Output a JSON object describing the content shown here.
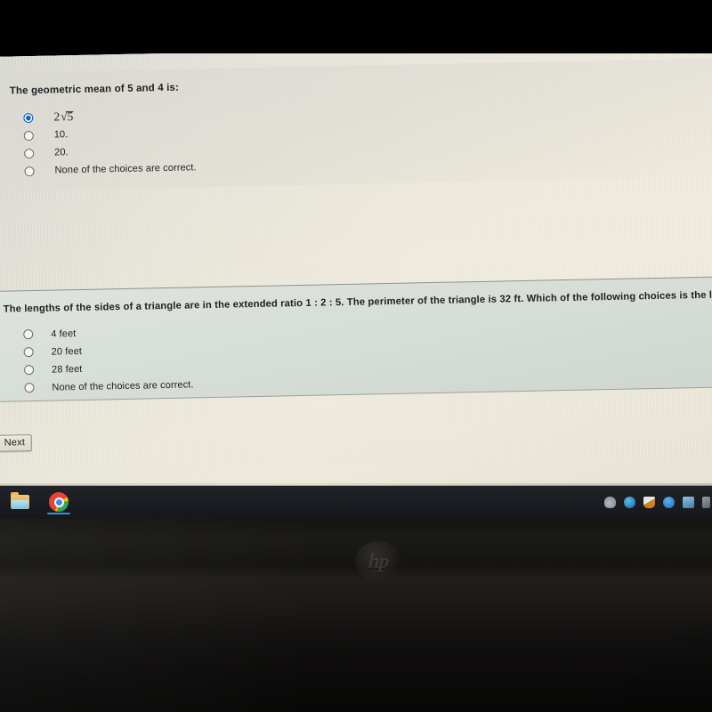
{
  "questions": [
    {
      "id": "q1",
      "prompt": "The geometric mean of 5 and 4 is:",
      "choices": [
        {
          "label": "2√5",
          "is_math": true,
          "selected": true
        },
        {
          "label": "10.",
          "is_math": false,
          "selected": false
        },
        {
          "label": "20.",
          "is_math": false,
          "selected": false
        },
        {
          "label": "None of the choices are correct.",
          "is_math": false,
          "selected": false
        }
      ]
    },
    {
      "id": "q2",
      "prompt": "The lengths of the sides of a triangle are in the extended ratio 1 : 2 : 5. The perimeter of the triangle is 32 ft. Which of the following choices is the length of the longest side?",
      "choices": [
        {
          "label": "4 feet",
          "is_math": false,
          "selected": false
        },
        {
          "label": "20 feet",
          "is_math": false,
          "selected": false
        },
        {
          "label": "28 feet",
          "is_math": false,
          "selected": false
        },
        {
          "label": "None of the choices are correct.",
          "is_math": false,
          "selected": false
        }
      ]
    }
  ],
  "actions": {
    "next_label": "Next"
  },
  "taskbar": {
    "pinned": [
      {
        "name": "file-explorer",
        "icon": "folder-icon",
        "active": false
      },
      {
        "name": "google-chrome",
        "icon": "chrome-icon",
        "active": true
      }
    ],
    "tray": [
      {
        "name": "cloud-storage",
        "icon": "cloud-icon"
      },
      {
        "name": "browser",
        "icon": "browser-icon"
      },
      {
        "name": "security",
        "icon": "shield-icon"
      },
      {
        "name": "bluetooth",
        "icon": "bluetooth-icon"
      },
      {
        "name": "display",
        "icon": "display-icon"
      },
      {
        "name": "edge-app",
        "icon": "edge-icon"
      }
    ]
  },
  "hardware": {
    "brand": "hp"
  },
  "colors": {
    "selected_radio": "#1565c0",
    "taskbar_bg": "#1a1c21",
    "active_indicator": "#3b8fe0",
    "page_bg": "#efeadb",
    "q2_panel_bg": "#d5dbd5"
  }
}
